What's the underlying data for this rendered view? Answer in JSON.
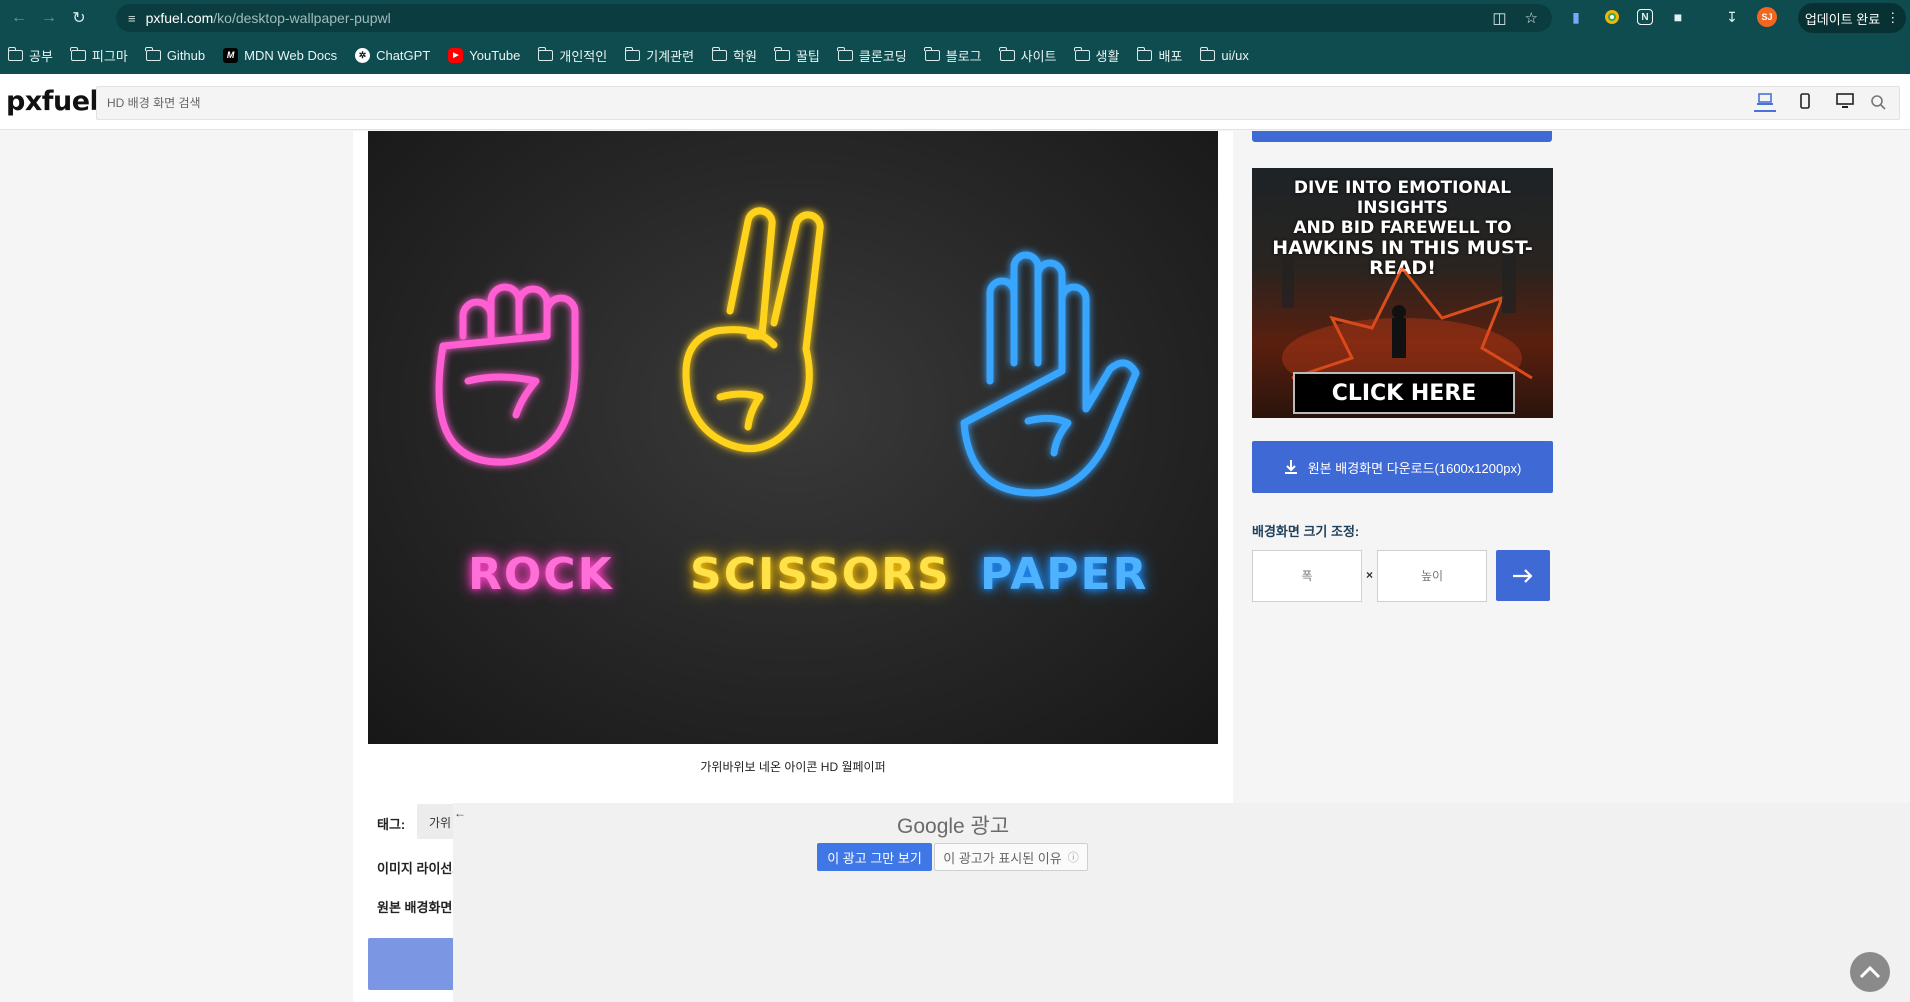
{
  "browser": {
    "url_host": "pxfuel.com",
    "url_path": "/ko/desktop-wallpaper-pupwl",
    "update_label": "업데이트 완료",
    "profile_initials": "SJ"
  },
  "bookmarks": [
    {
      "label": "공부",
      "type": "folder"
    },
    {
      "label": "피그마",
      "type": "folder"
    },
    {
      "label": "Github",
      "type": "folder"
    },
    {
      "label": "MDN Web Docs",
      "type": "mdn"
    },
    {
      "label": "ChatGPT",
      "type": "gpt"
    },
    {
      "label": "YouTube",
      "type": "yt"
    },
    {
      "label": "개인적인",
      "type": "folder"
    },
    {
      "label": "기계관련",
      "type": "folder"
    },
    {
      "label": "학원",
      "type": "folder"
    },
    {
      "label": "꿀팁",
      "type": "folder"
    },
    {
      "label": "클론코딩",
      "type": "folder"
    },
    {
      "label": "블로그",
      "type": "folder"
    },
    {
      "label": "사이트",
      "type": "folder"
    },
    {
      "label": "생활",
      "type": "folder"
    },
    {
      "label": "배포",
      "type": "folder"
    },
    {
      "label": "ui/ux",
      "type": "folder"
    }
  ],
  "site": {
    "logo": "pxfuel",
    "search_placeholder": "HD 배경 화면 검색"
  },
  "wallpaper": {
    "labels": [
      {
        "text": "ROCK",
        "color": "#ff5fd2"
      },
      {
        "text": "SCISSORS",
        "color": "#ffd21f"
      },
      {
        "text": "PAPER",
        "color": "#39a6ff"
      }
    ],
    "caption": "가위바위보 네온 아이콘 HD 월페이퍼"
  },
  "ad_banner": {
    "line1": "DIVE INTO EMOTIONAL INSIGHTS",
    "line2": "AND BID FAREWELL TO",
    "line3": "HAWKINS IN THIS MUST-READ!",
    "cta": "CLICK HERE"
  },
  "sidebar": {
    "download_label": "원본 배경화면 다운로드(1600x1200px)",
    "resize_title": "배경화면 크기 조정:",
    "width_placeholder": "폭",
    "height_placeholder": "높이",
    "times": "×"
  },
  "info": {
    "tags_label": "태그:",
    "first_tag_visible": "가위",
    "license_label": "이미지 라이선스",
    "original_label": "원본 배경화면"
  },
  "google_ad": {
    "label": "Google 광고",
    "stop_label": "이 광고 그만 보기",
    "why_label": "이 광고가 표시된 이유",
    "info_glyph": "ⓘ"
  }
}
